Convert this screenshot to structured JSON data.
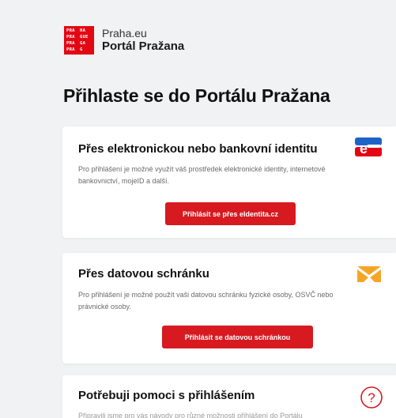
{
  "header": {
    "logo_lines": [
      "PRA",
      "HA",
      "PRA",
      "GUE",
      "PRA",
      "GA",
      "PRA",
      "G"
    ],
    "brand_top": "Praha.eu",
    "brand_bottom": "Portál Pražana"
  },
  "page_title": "Přihlaste se do Portálu Pražana",
  "cards": [
    {
      "title": "Přes elektronickou nebo bankovní identitu",
      "text": "Pro přihlášení je možné využít váš prostředek elektronické identity, internetové bankovnictví, mojeID a další.",
      "button": "Přihlásit se přes eIdentita.cz",
      "icon": "eidentita-icon"
    },
    {
      "title": "Přes datovou schránku",
      "text": "Pro přihlášení je možné použít vaši datovou schránku fyzické osoby, OSVČ nebo právnické osoby.",
      "button": "Přihlásit se datovou schránkou",
      "icon": "datova-schranka-icon"
    },
    {
      "title": "Potřebuji pomoci s přihlášením",
      "text": "Připravili jsme pro vás návody pro různé možnosti přihlášení do Portálu",
      "icon": "help-icon"
    }
  ],
  "colors": {
    "accent_red": "#d71920",
    "logo_red": "#e30613",
    "eid_blue": "#1e64c8",
    "ds_orange": "#f5a524"
  }
}
